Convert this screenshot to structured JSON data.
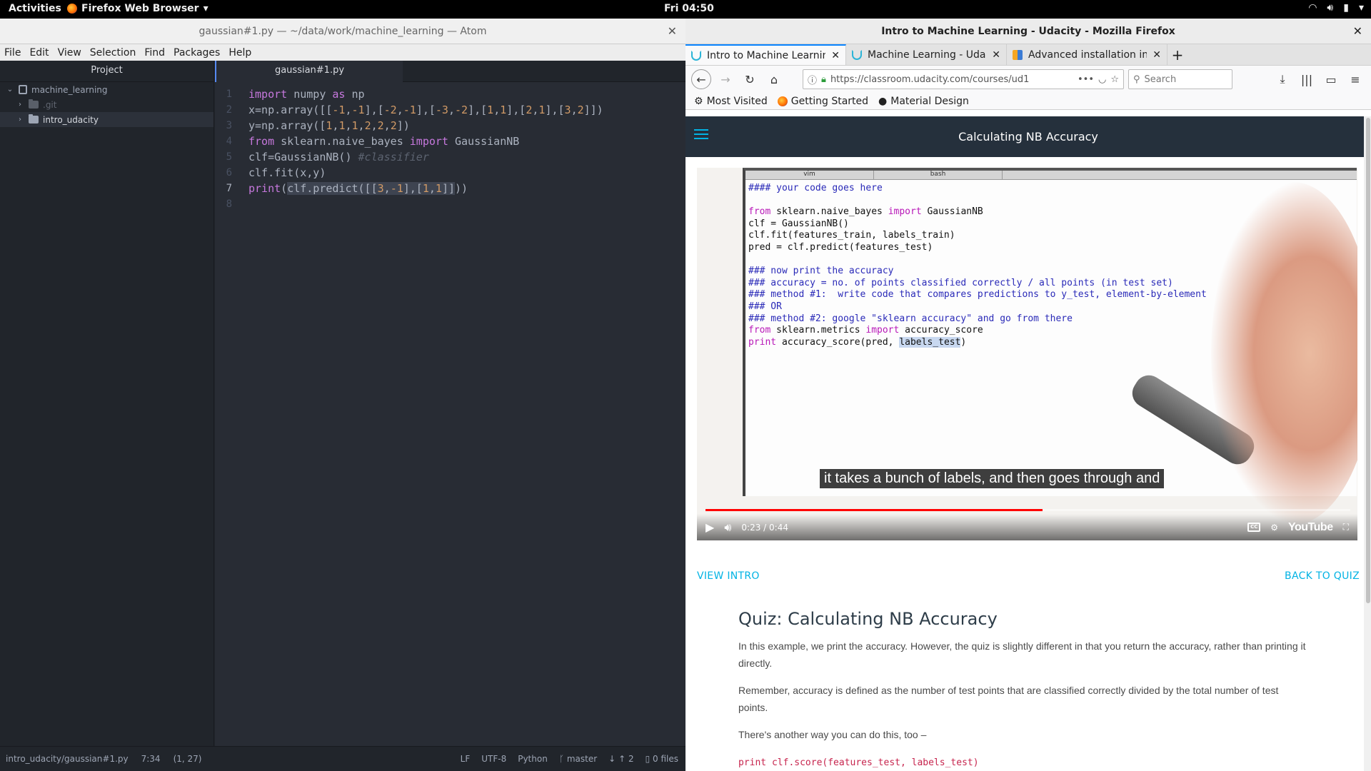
{
  "topbar": {
    "activities": "Activities",
    "app_name": "Firefox Web Browser",
    "clock": "Fri 04:50"
  },
  "atom": {
    "window_title": "gaussian#1.py — ~/data/work/machine_learning — Atom",
    "menu": [
      "File",
      "Edit",
      "View",
      "Selection",
      "Find",
      "Packages",
      "Help"
    ],
    "tree_header": "Project",
    "tree": {
      "root": "machine_learning",
      "git": ".git",
      "folder": "intro_udacity"
    },
    "tab_title": "gaussian#1.py",
    "code_lines": [
      "import numpy as np",
      "x=np.array([[-1,-1],[-2,-1],[-3,-2],[1,1],[2,1],[3,2]])",
      "y=np.array([1,1,1,2,2,2])",
      "from sklearn.naive_bayes import GaussianNB",
      "clf=GaussianNB() #classifier",
      "clf.fit(x,y)",
      "print(clf.predict([[3,-1],[1,1]]))",
      ""
    ],
    "line_numbers": [
      "1",
      "2",
      "3",
      "4",
      "5",
      "6",
      "7",
      "8"
    ],
    "status": {
      "path": "intro_udacity/gaussian#1.py",
      "cursor": "7:34",
      "selection": "(1, 27)",
      "line_ending": "LF",
      "encoding": "UTF-8",
      "grammar": "Python",
      "branch": "master",
      "push_count": "2",
      "files": "0 files"
    }
  },
  "firefox": {
    "window_title": "Intro to Machine Learning - Udacity - Mozilla Firefox",
    "tabs": [
      {
        "label": "Intro to Machine Learning"
      },
      {
        "label": "Machine Learning - Udacity"
      },
      {
        "label": "Advanced installation inst"
      }
    ],
    "url": "https://classroom.udacity.com/courses/ud1",
    "search_placeholder": "Search",
    "bookmarks": [
      "Most Visited",
      "Getting Started",
      "Material Design"
    ],
    "page": {
      "header_title": "Calculating NB Accuracy",
      "video": {
        "code_lines": [
          "#### your code goes here",
          "",
          "from sklearn.naive_bayes import GaussianNB",
          "clf = GaussianNB()",
          "clf.fit(features_train, labels_train)",
          "pred = clf.predict(features_test)",
          "",
          "### now print the accuracy",
          "### accuracy = no. of points classified correctly / all points (in test set)",
          "### method #1:  write code that compares predictions to y_test, element-by-element",
          "### OR",
          "### method #2: google \"sklearn accuracy\" and go from there",
          "from sklearn.metrics import accuracy_score",
          "print accuracy_score(pred, labels_test)"
        ],
        "vim_tabs": [
          "vim",
          "bash"
        ],
        "caption": "it takes a bunch of labels, and then goes through and",
        "time": "0:23 / 0:44",
        "progress_fraction": 0.523,
        "youtube_label": "YouTube"
      },
      "link_left": "VIEW INTRO",
      "link_right": "BACK TO QUIZ",
      "article": {
        "heading": "Quiz: Calculating NB Accuracy",
        "p1": "In this example, we print the accuracy. However, the quiz is slightly different in that you return the accuracy, rather than printing it directly.",
        "p2": "Remember, accuracy is defined as the number of test points that are classified correctly divided by the total number of test points.",
        "p3": "There's another way you can do this, too –",
        "code": "print clf.score(features_test, labels_test)"
      }
    }
  }
}
